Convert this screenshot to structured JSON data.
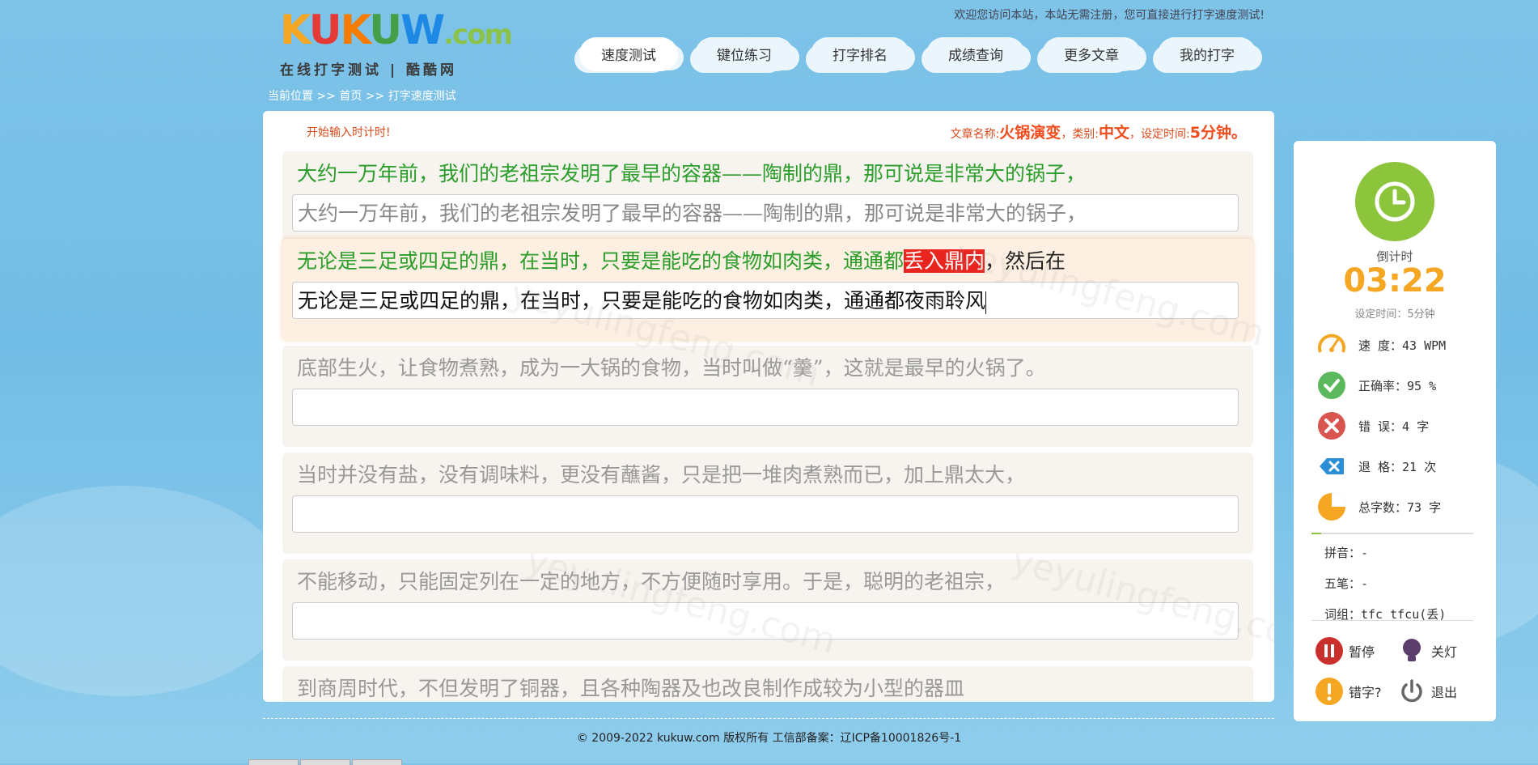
{
  "header": {
    "logo_text": "KUKUW.com",
    "logo_sub": "在线打字测试 | 酷酷网",
    "welcome": "欢迎您访问本站，本站无需注册，您可直接进行打字速度测试!"
  },
  "nav": {
    "items": [
      {
        "label": "速度测试"
      },
      {
        "label": "键位练习"
      },
      {
        "label": "打字排名"
      },
      {
        "label": "成绩查询"
      },
      {
        "label": "更多文章"
      },
      {
        "label": "我的打字"
      }
    ]
  },
  "breadcrumb": "当前位置 >> 首页 >> 打字速度测试",
  "main": {
    "start_hint": "开始输入时计时!",
    "article_label": "文章名称:",
    "article_name": "火锅演变",
    "category_label": "类别:",
    "category": "中文",
    "time_label": "设定时间:",
    "time": "5分钟。",
    "lines": [
      {
        "text_ok": "大约一万年前，我们的老祖宗发明了最早的容器——陶制的鼎，那可说是非常大的锅子，",
        "typed": "大约一万年前，我们的老祖宗发明了最早的容器——陶制的鼎，那可说是非常大的锅子，"
      },
      {
        "text_ok": "无论是三足或四足的鼎，在当时，只要是能吃的食物如肉类，通通都",
        "text_err": "丢入鼎内",
        "text_rest": "，然后在",
        "typed": "无论是三足或四足的鼎，在当时，只要是能吃的食物如肉类，通通都夜雨聆风"
      },
      {
        "text": "底部生火，让食物煮熟，成为一大锅的食物，当时叫做“羹”，这就是最早的火锅了。",
        "typed": ""
      },
      {
        "text": "当时并没有盐，没有调味料，更没有蘸酱，只是把一堆肉煮熟而已，加上鼎太大，",
        "typed": ""
      },
      {
        "text": "不能移动，只能固定列在一定的地方，不方便随时享用。于是，聪明的老祖宗，",
        "typed": ""
      },
      {
        "text": "到商周时代，不但发明了铜器，且各种陶器及也改良制作成较为小型的器皿",
        "typed": ""
      }
    ]
  },
  "side": {
    "countdown_label": "倒计时",
    "countdown": "03:22",
    "set_time": "设定时间：5分钟",
    "stats": [
      {
        "label": "速  度：43 WPM",
        "icon": "speedometer-icon"
      },
      {
        "label": "正确率：95 %",
        "icon": "check-icon"
      },
      {
        "label": "错  误：4 字",
        "icon": "error-icon"
      },
      {
        "label": "退  格：21 次",
        "icon": "backspace-icon"
      },
      {
        "label": "总字数：73 字",
        "icon": "pie-icon"
      }
    ],
    "pinyin": "拼音：-",
    "wubi": "五笔：-",
    "phrase": "词组：tfc tfcu(丢)",
    "controls": {
      "pause": "暂停",
      "lights_off": "关灯",
      "typo": "错字?",
      "exit": "退出"
    }
  },
  "footer": "© 2009-2022 kukuw.com 版权所有 工信部备案：辽ICP备10001826号-1",
  "watermark": "yeyulingfeng.com",
  "colors": {
    "accent": "#f5a623",
    "ok": "#2a9d2a",
    "err": "#e8261f",
    "green": "#8cc43c"
  }
}
